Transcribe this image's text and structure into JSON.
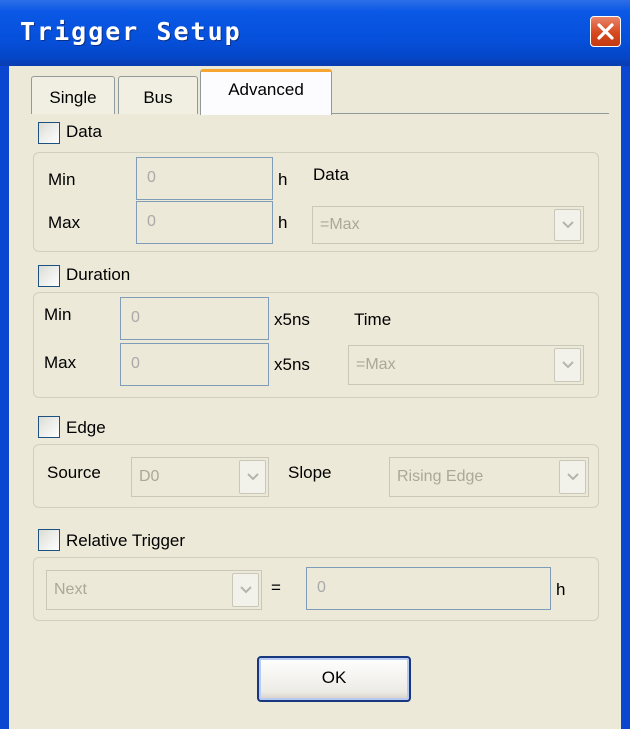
{
  "window": {
    "title": "Trigger Setup"
  },
  "tabs": [
    {
      "label": "Single"
    },
    {
      "label": "Bus"
    },
    {
      "label": "Advanced"
    }
  ],
  "data_section": {
    "label": "Data",
    "min_label": "Min",
    "min_value": "0",
    "min_unit": "h",
    "max_label": "Max",
    "max_value": "0",
    "max_unit": "h",
    "mode_label": "Data",
    "mode_value": "=Max"
  },
  "duration_section": {
    "label": "Duration",
    "min_label": "Min",
    "min_value": "0",
    "min_unit": "x5ns",
    "max_label": "Max",
    "max_value": "0",
    "max_unit": "x5ns",
    "mode_label": "Time",
    "mode_value": "=Max"
  },
  "edge_section": {
    "label": "Edge",
    "source_label": "Source",
    "source_value": "D0",
    "slope_label": "Slope",
    "slope_value": "Rising Edge"
  },
  "relative_section": {
    "label": "Relative Trigger",
    "mode_value": "Next",
    "equals": "=",
    "value": "0",
    "unit": "h"
  },
  "buttons": {
    "ok": "OK"
  }
}
